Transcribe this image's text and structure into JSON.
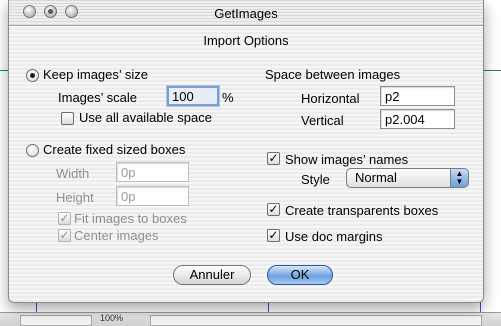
{
  "window": {
    "title": "GetImages",
    "subtitle": "Import Options"
  },
  "left": {
    "keep_size_label": "Keep images’ size",
    "scale_label": "Images’ scale",
    "scale_value": "100",
    "scale_unit": "%",
    "use_all_space_label": "Use all available space",
    "fixed_boxes_label": "Create fixed sized boxes",
    "width_label": "Width",
    "width_value": "0p",
    "height_label": "Height",
    "height_value": "0p",
    "fit_label": "Fit images to boxes",
    "center_label": "Center images"
  },
  "right": {
    "space_heading": "Space between images",
    "horizontal_label": "Horizontal",
    "horizontal_value": "p2",
    "vertical_label": "Vertical",
    "vertical_value": "p2.004",
    "show_names_label": "Show images’ names",
    "style_label": "Style",
    "style_value": "Normal",
    "transparent_label": "Create transparents boxes",
    "doc_margins_label": "Use doc margins"
  },
  "buttons": {
    "cancel": "Annuler",
    "ok": "OK"
  },
  "statusbar": {
    "zoom": "100%"
  }
}
